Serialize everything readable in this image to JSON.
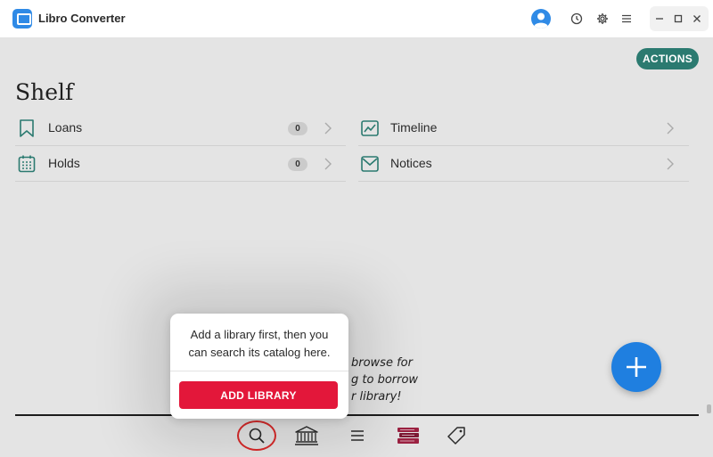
{
  "window": {
    "app_title": "Libro Converter",
    "icons": [
      "app-logo",
      "user-avatar-icon",
      "history-icon",
      "gear-icon",
      "menu-icon",
      "minimize-icon",
      "maximize-icon",
      "close-icon"
    ]
  },
  "colors": {
    "accent_teal": "#2b7a70",
    "fab_blue": "#1f7fe0",
    "primary_red": "#e3173a",
    "focus_ring": "#d82a2a",
    "background": "#e4e4e4"
  },
  "header": {
    "actions_label": "ACTIONS",
    "title": "Shelf"
  },
  "shelf": {
    "left": [
      {
        "label": "Loans",
        "badge": "0",
        "icon": "bookmark-icon"
      },
      {
        "label": "Holds",
        "badge": "0",
        "icon": "calendar-icon"
      }
    ],
    "right": [
      {
        "label": "Timeline",
        "icon": "trend-chart-icon"
      },
      {
        "label": "Notices",
        "icon": "envelope-icon"
      }
    ]
  },
  "background_text": {
    "line1": "browse for",
    "line2": "g to borrow",
    "line3": "r library!"
  },
  "popup": {
    "message": "Add a library first, then you can search its catalog here.",
    "button_label": "ADD LIBRARY"
  },
  "bottom_nav": [
    "search-icon",
    "library-building-icon",
    "menu-lines-icon",
    "books-stack-icon",
    "tag-icon"
  ]
}
